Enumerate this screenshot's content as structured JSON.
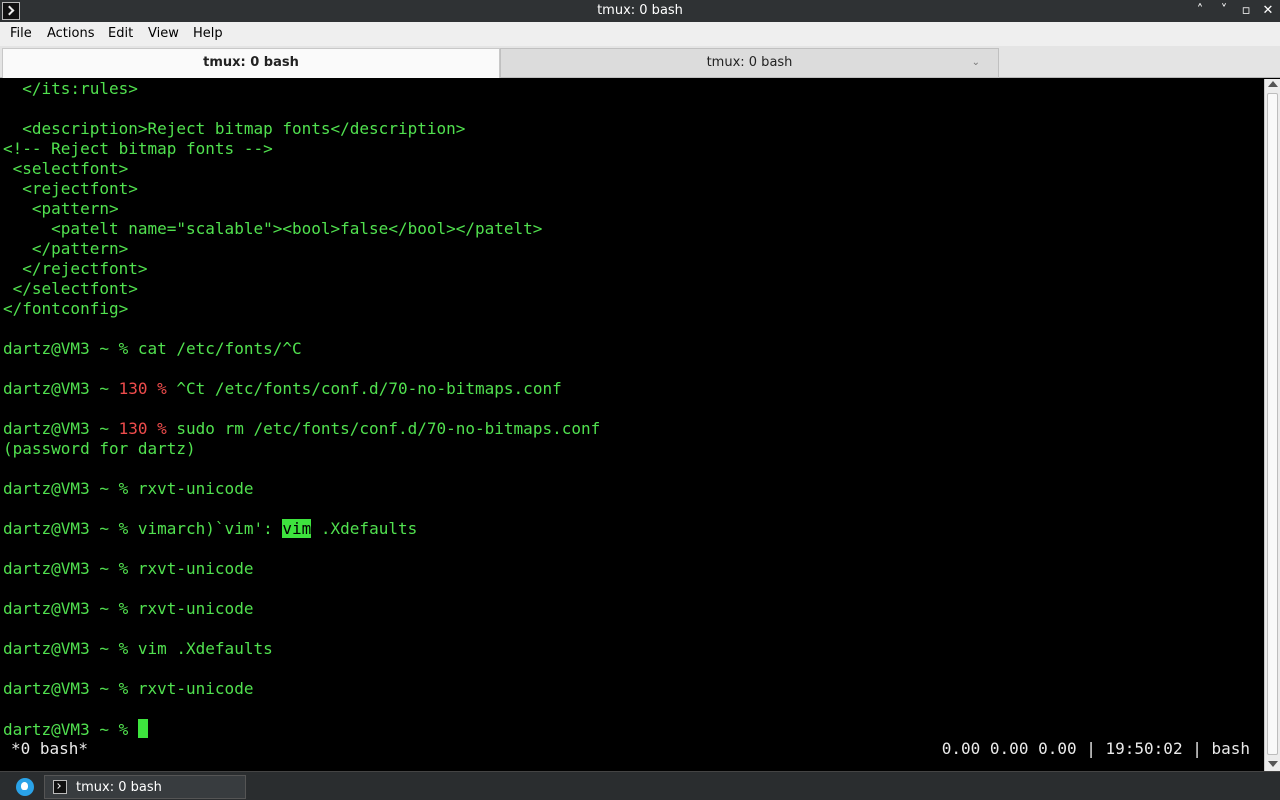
{
  "window": {
    "title": "tmux: 0 bash",
    "controls": {
      "minimize": "˄",
      "maximize": "˅",
      "restore": "▫",
      "close": "✕"
    }
  },
  "menu": {
    "items": [
      "File",
      "Actions",
      "Edit",
      "View",
      "Help"
    ]
  },
  "tabs": [
    {
      "label": "tmux: 0 bash",
      "active": true
    },
    {
      "label": "tmux: 0 bash",
      "active": false,
      "close_glyph": "⌄"
    }
  ],
  "terminal": {
    "prompt": "dartz@VM3 ~ ",
    "lines": {
      "l0": "  </its:rules>",
      "l2": "  <description>Reject bitmap fonts</description>",
      "l3": "<!-- Reject bitmap fonts -->",
      "l4": " <selectfont>",
      "l5": "  <rejectfont>",
      "l6": "   <pattern>",
      "l7": "     <patelt name=\"scalable\"><bool>false</bool></patelt>",
      "l8": "   </pattern>",
      "l9": "  </rejectfont>",
      "l10": " </selectfont>",
      "l11": "</fontconfig>",
      "l13_cmd": "% cat /etc/fonts/^C",
      "l15_code": "130 %",
      "l15_cmd": " ^Ct /etc/fonts/conf.d/70-no-bitmaps.conf",
      "l17_code": "130 %",
      "l17_cmd": " sudo rm /etc/fonts/conf.d/70-no-bitmaps.conf",
      "l18": "(password for dartz)",
      "l20_cmd": "% rxvt-unicode",
      "l22_pre": "% vimarch)`vim': ",
      "l22_hl": "vim",
      "l22_post": " .Xdefaults",
      "l24_cmd": "% rxvt-unicode",
      "l26_cmd": "% rxvt-unicode",
      "l28_cmd": "% vim .Xdefaults",
      "l30_cmd": "% rxvt-unicode",
      "l32_cmd": "% "
    },
    "status_left": "*0 bash*",
    "status_right": "0.00 0.00 0.00 | 19:50:02 | bash"
  },
  "taskbar": {
    "item_label": "tmux: 0 bash"
  },
  "colors": {
    "term_fg": "#51e14f",
    "term_bg": "#000000",
    "exit_code": "#ef4c4c",
    "cursor": "#3ee43e"
  }
}
